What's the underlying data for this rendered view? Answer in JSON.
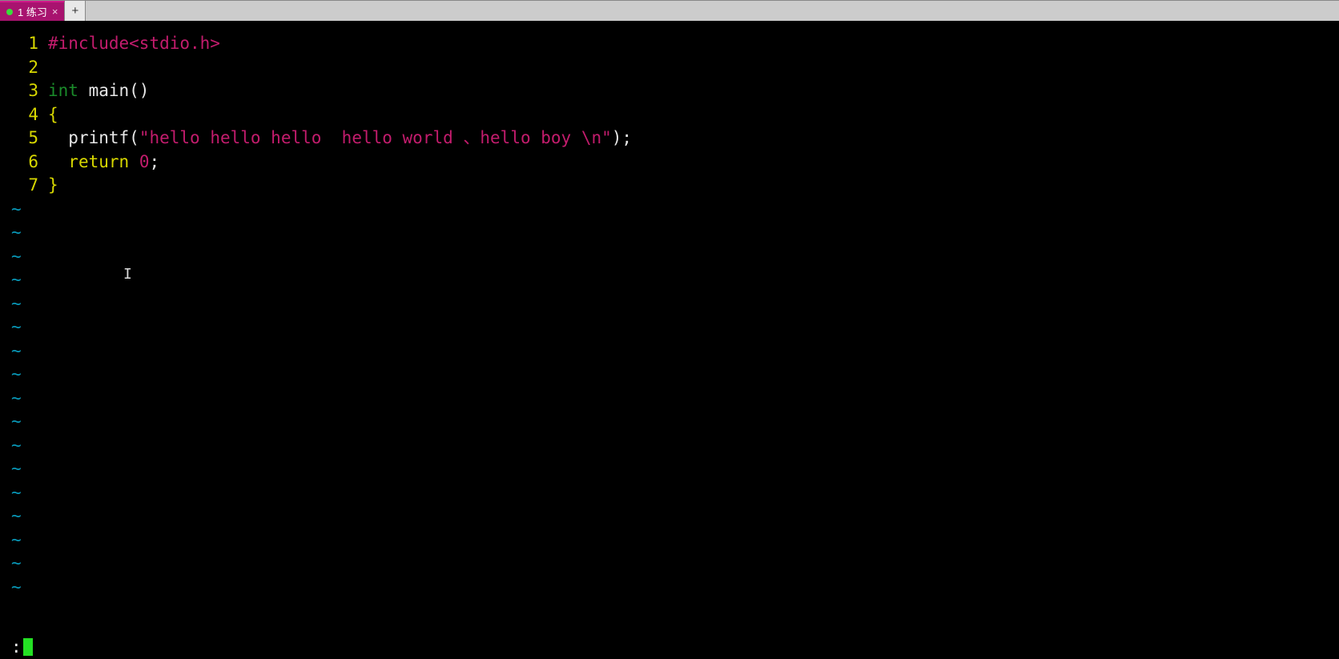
{
  "tabbar": {
    "active_tab_label": "1 练习",
    "new_tab_label": "+"
  },
  "editor": {
    "lines": [
      {
        "num": "1",
        "tokens": [
          {
            "cls": "c-preproc",
            "t": "#include"
          },
          {
            "cls": "c-header",
            "t": "<stdio.h>"
          }
        ]
      },
      {
        "num": "2",
        "tokens": []
      },
      {
        "num": "3",
        "tokens": [
          {
            "cls": "c-type",
            "t": "int"
          },
          {
            "cls": "c-ident",
            "t": " main"
          },
          {
            "cls": "c-punct",
            "t": "()"
          }
        ]
      },
      {
        "num": "4",
        "tokens": [
          {
            "cls": "c-brace",
            "t": "{"
          }
        ]
      },
      {
        "num": "5",
        "tokens": [
          {
            "cls": "c-punct",
            "t": "  "
          },
          {
            "cls": "c-ident",
            "t": "printf"
          },
          {
            "cls": "c-punct",
            "t": "("
          },
          {
            "cls": "c-string",
            "t": "\"hello hello hello  hello world "
          },
          {
            "cls": "c-comma",
            "t": "、"
          },
          {
            "cls": "c-string",
            "t": "hello boy "
          },
          {
            "cls": "c-string",
            "t": "\\n"
          },
          {
            "cls": "c-string",
            "t": "\""
          },
          {
            "cls": "c-punct",
            "t": ");"
          }
        ]
      },
      {
        "num": "6",
        "tokens": [
          {
            "cls": "c-punct",
            "t": "  "
          },
          {
            "cls": "c-keyword",
            "t": "return"
          },
          {
            "cls": "c-punct",
            "t": " "
          },
          {
            "cls": "c-number",
            "t": "0"
          },
          {
            "cls": "c-punct",
            "t": ";"
          }
        ]
      },
      {
        "num": "7",
        "tokens": [
          {
            "cls": "c-brace",
            "t": "}"
          }
        ]
      }
    ],
    "tilde_count": 17,
    "tilde_char": "~",
    "text_cursor_glyph": "I"
  },
  "cmdline": {
    "prompt": ":"
  }
}
